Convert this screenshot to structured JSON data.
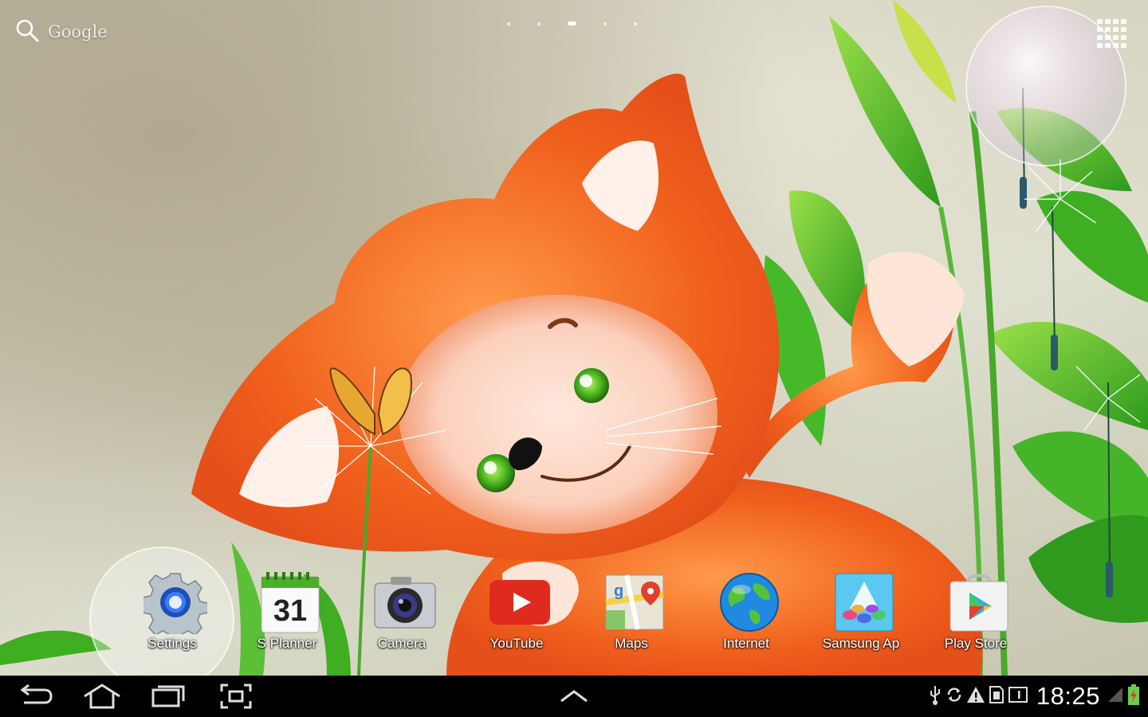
{
  "search": {
    "label": "Google"
  },
  "pages": {
    "count": 5,
    "active": 2
  },
  "dock": {
    "apps": [
      {
        "label": "Settings",
        "icon": "settings-gear-icon"
      },
      {
        "label": "S Planner",
        "icon": "calendar-icon",
        "calendar_day": "31"
      },
      {
        "label": "Camera",
        "icon": "camera-icon"
      },
      {
        "label": "YouTube",
        "icon": "youtube-icon"
      },
      {
        "label": "Maps",
        "icon": "maps-icon"
      },
      {
        "label": "Internet",
        "icon": "globe-icon"
      },
      {
        "label": "Samsung Ap",
        "icon": "samsung-apps-icon"
      },
      {
        "label": "Play Store",
        "icon": "play-store-icon"
      }
    ]
  },
  "status": {
    "time": "18:25"
  },
  "colors": {
    "fox_orange": "#f0601c",
    "leaf_green": "#3fae22",
    "youtube_red": "#e02a20"
  }
}
